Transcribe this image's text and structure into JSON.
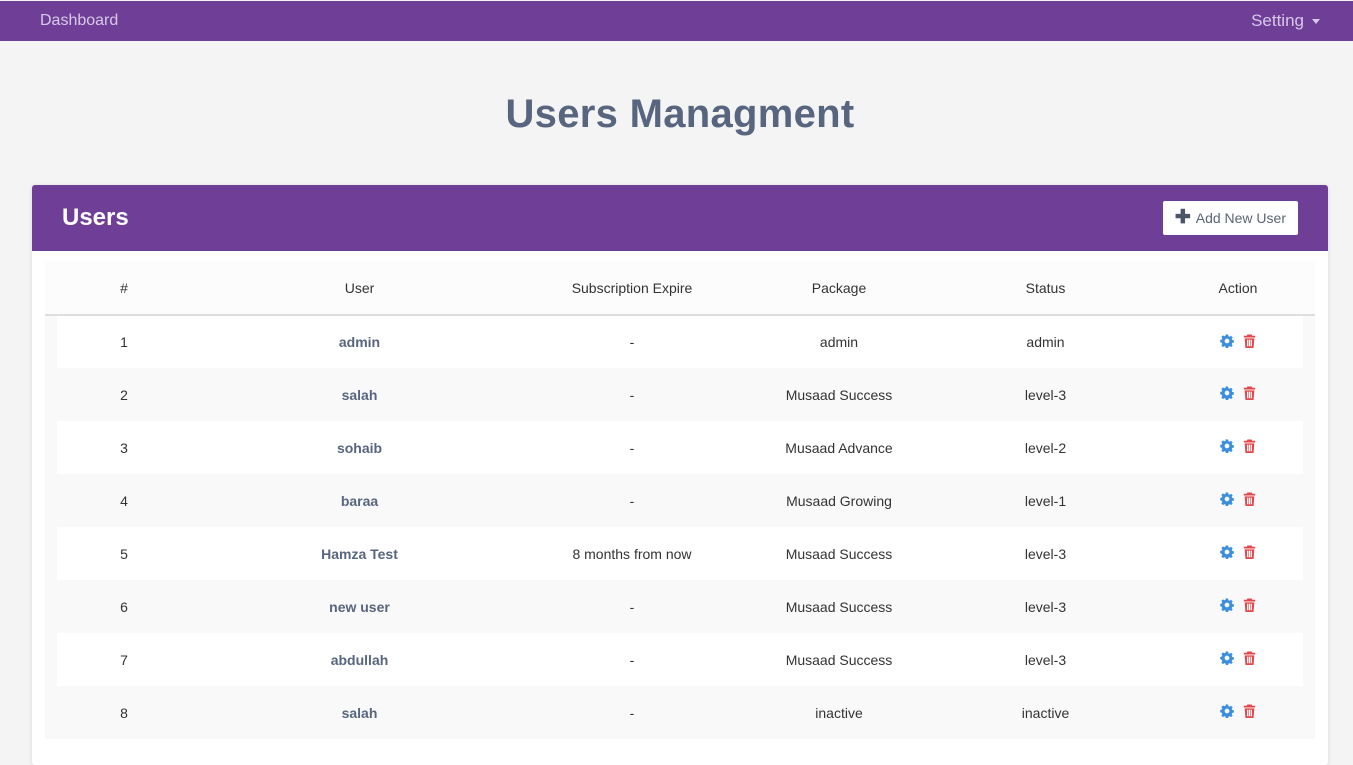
{
  "nav": {
    "brand": "Dashboard",
    "setting": "Setting"
  },
  "page": {
    "title": "Users Managment"
  },
  "card": {
    "title": "Users",
    "add_button": "Add New User"
  },
  "table": {
    "headers": [
      "#",
      "User",
      "Subscription Expire",
      "Package",
      "Status",
      "Action"
    ],
    "rows": [
      {
        "num": "1",
        "user": "admin",
        "expire": "-",
        "package": "admin",
        "status": "admin"
      },
      {
        "num": "2",
        "user": "salah",
        "expire": "-",
        "package": "Musaad Success",
        "status": "level-3"
      },
      {
        "num": "3",
        "user": "sohaib",
        "expire": "-",
        "package": "Musaad Advance",
        "status": "level-2"
      },
      {
        "num": "4",
        "user": "baraa",
        "expire": "-",
        "package": "Musaad Growing",
        "status": "level-1"
      },
      {
        "num": "5",
        "user": "Hamza Test",
        "expire": "8 months from now",
        "package": "Musaad Success",
        "status": "level-3"
      },
      {
        "num": "6",
        "user": "new user",
        "expire": "-",
        "package": "Musaad Success",
        "status": "level-3"
      },
      {
        "num": "7",
        "user": "abdullah",
        "expire": "-",
        "package": "Musaad Success",
        "status": "level-3"
      },
      {
        "num": "8",
        "user": "salah",
        "expire": "-",
        "package": "inactive",
        "status": "inactive"
      }
    ]
  },
  "icons": {
    "settings": "gear-icon",
    "delete": "trash-icon",
    "add": "plus-icon",
    "dropdown": "caret-down-icon"
  },
  "colors": {
    "brand": "#6f3f98",
    "title": "#58657f",
    "gear": "#3d8fde",
    "trash": "#e2474b"
  }
}
